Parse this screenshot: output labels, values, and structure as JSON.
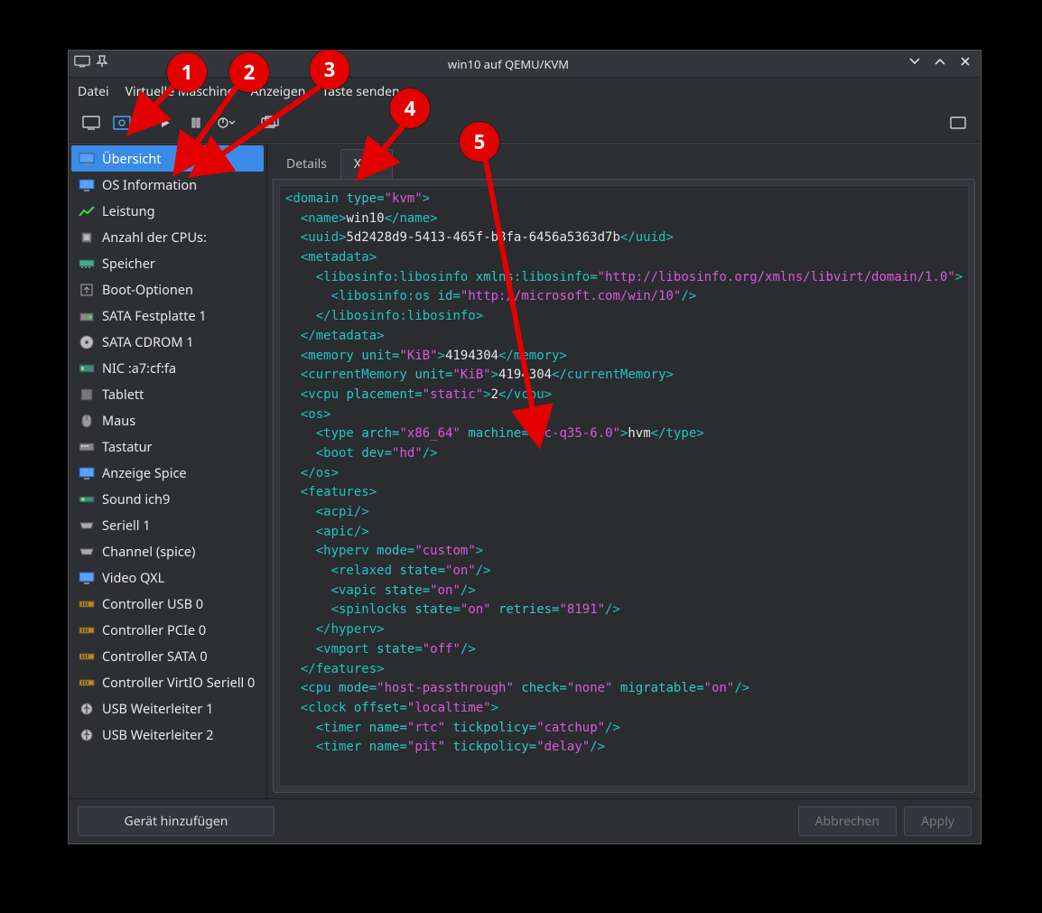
{
  "window": {
    "title": "win10 auf QEMU/KVM"
  },
  "menu": {
    "file": "Datei",
    "vm": "Virtuelle Maschine",
    "view": "Anzeigen",
    "sendkey": "Taste senden"
  },
  "sidebar": {
    "items": [
      {
        "label": "Übersicht",
        "icon": "monitor"
      },
      {
        "label": "OS Information",
        "icon": "monitor"
      },
      {
        "label": "Leistung",
        "icon": "chart"
      },
      {
        "label": "Anzahl der CPUs:",
        "icon": "cpu"
      },
      {
        "label": "Speicher",
        "icon": "mem"
      },
      {
        "label": "Boot-Optionen",
        "icon": "boot"
      },
      {
        "label": "SATA Festplatte 1",
        "icon": "disk"
      },
      {
        "label": "SATA CDROM 1",
        "icon": "cd"
      },
      {
        "label": "NIC :a7:cf:fa",
        "icon": "nic"
      },
      {
        "label": "Tablett",
        "icon": "tablet"
      },
      {
        "label": "Maus",
        "icon": "mouse"
      },
      {
        "label": "Tastatur",
        "icon": "keyboard"
      },
      {
        "label": "Anzeige Spice",
        "icon": "monitor"
      },
      {
        "label": "Sound ich9",
        "icon": "sound"
      },
      {
        "label": "Seriell 1",
        "icon": "serial"
      },
      {
        "label": "Channel (spice)",
        "icon": "serial"
      },
      {
        "label": "Video QXL",
        "icon": "monitor"
      },
      {
        "label": "Controller USB 0",
        "icon": "ctrl"
      },
      {
        "label": "Controller PCIe 0",
        "icon": "ctrl"
      },
      {
        "label": "Controller SATA 0",
        "icon": "ctrl"
      },
      {
        "label": "Controller VirtIO Seriell 0",
        "icon": "ctrl"
      },
      {
        "label": "USB Weiterleiter 1",
        "icon": "usb"
      },
      {
        "label": "USB Weiterleiter 2",
        "icon": "usb"
      }
    ]
  },
  "tabs": {
    "details": "Details",
    "xml": "XML"
  },
  "buttons": {
    "add": "Gerät hinzufügen",
    "cancel": "Abbrechen",
    "apply": "Apply"
  },
  "annotations": [
    "1",
    "2",
    "3",
    "4",
    "5"
  ],
  "xml": {
    "domain_type": "kvm",
    "name": "win10",
    "uuid": "5d2428d9-5413-465f-b8fa-6456a5363d7b",
    "libosinfo_xmlns": "http://libosinfo.org/xmlns/libvirt/domain/1.0",
    "libosinfo_os_id": "http://microsoft.com/win/10",
    "memory_unit": "KiB",
    "memory": "4194304",
    "currentMemory": "4194304",
    "vcpu_placement": "static",
    "vcpu": "2",
    "os_type_arch": "x86_64",
    "os_type_machine": "pc-q35-6.0",
    "os_type_text": "hvm",
    "boot_dev": "hd",
    "hyperv_mode": "custom",
    "relaxed": "on",
    "vapic": "on",
    "spinlocks_state": "on",
    "spinlocks_retries": "8191",
    "vmport": "off",
    "cpu_mode": "host-passthrough",
    "cpu_check": "none",
    "cpu_migratable": "on",
    "clock_offset": "localtime",
    "timer_rtc_tickpolicy": "catchup",
    "timer_pit_tickpolicy": "delay"
  }
}
